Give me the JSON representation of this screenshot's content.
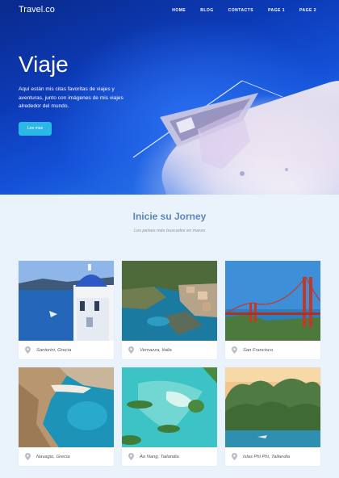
{
  "header": {
    "brand": "Travel.co",
    "nav": [
      "HOME",
      "BLOG",
      "CONTACTS",
      "PAGE 1",
      "PAGE 2"
    ]
  },
  "hero": {
    "title": "Viaje",
    "description": "Aquí están mis citas favoritas de viajes y aventuras, junto con imágenes de mis viajes alrededor del mundo.",
    "button_label": "Lee mas"
  },
  "section": {
    "title": "Inicie su Jorney",
    "subtitle": "Los países más buscados en marzo"
  },
  "cards": [
    {
      "label": "Santorini, Grecia",
      "icon": "location-pin-icon"
    },
    {
      "label": "Vernazza, Italia",
      "icon": "location-pin-icon"
    },
    {
      "label": "San Francisco",
      "icon": "location-pin-icon"
    },
    {
      "label": "Navagio, Grecia",
      "icon": "location-pin-icon"
    },
    {
      "label": "Ao Nang, Tailandia",
      "icon": "location-pin-icon"
    },
    {
      "label": "Islas Phi Phi, Tailandia",
      "icon": "location-pin-icon"
    }
  ],
  "colors": {
    "accent": "#2bb8e6",
    "section_title": "#5a86b8",
    "page_bg": "#eaf2fb"
  }
}
